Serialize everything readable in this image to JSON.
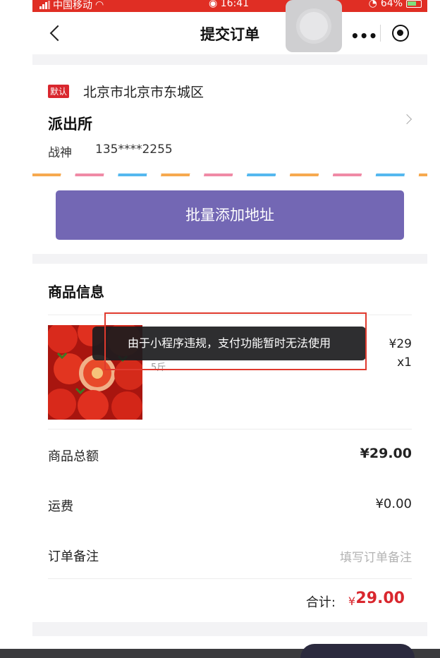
{
  "status_bar": {
    "carrier": "中国移动",
    "time": "16:41",
    "battery": "64%"
  },
  "nav": {
    "title": "提交订单",
    "more_glyph": "•••"
  },
  "address": {
    "default_tag": "默认",
    "region": "北京市北京市东城区",
    "detail": "派出所",
    "contact_name": "战神",
    "phone": "135****2255"
  },
  "batch_button_label": "批量添加地址",
  "goods": {
    "section_title": "商品信息",
    "product": {
      "spec": "5斤",
      "price": "¥29",
      "quantity": "x1"
    },
    "subtotal_label": "商品总额",
    "subtotal_value": "¥29.00",
    "shipping_label": "运费",
    "shipping_value": "¥0.00",
    "remark_label": "订单备注",
    "remark_placeholder": "填写订单备注",
    "total_label": "合计:",
    "total_currency": "¥",
    "total_value": "29.00"
  },
  "toast": {
    "message": "由于小程序违规，支付功能暂时无法使用"
  },
  "colors": {
    "status_bar": "#e02e24",
    "accent_red": "#d9272e",
    "batch_button": "#7367b4",
    "toast_bg": "#1c1c1e",
    "annotation_border": "#e03a2e"
  },
  "icons": {
    "back": "back-arrow-icon",
    "more": "more-dots-icon",
    "close": "target-close-icon",
    "chevron": "chevron-right-icon"
  }
}
